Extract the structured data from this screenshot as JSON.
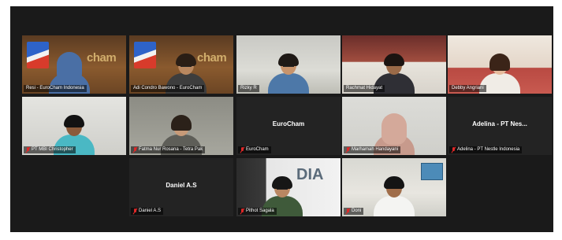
{
  "meeting": {
    "participants": [
      {
        "name": "Resi - EuroCham Indonesia",
        "video": true,
        "active_speaker": true,
        "muted": false
      },
      {
        "name": "Adi Condro Bawono - EuroCham",
        "video": true,
        "muted": false
      },
      {
        "name": "Rizky R",
        "video": true,
        "muted": false
      },
      {
        "name": "Rachmat Hidayat",
        "video": true,
        "muted": false
      },
      {
        "name": "Debby Angriani",
        "video": true,
        "muted": false
      },
      {
        "name": "PT MBI Christopher",
        "video": true,
        "muted": true
      },
      {
        "name": "Fatma Nur Rosana - Tetra Pak",
        "video": true,
        "muted": true
      },
      {
        "name": "EuroCham",
        "display_name": "EuroCham",
        "video": false,
        "muted": true
      },
      {
        "name": "Marhamah Handayani",
        "video": true,
        "muted": true
      },
      {
        "name": "Adelina - PT Nestle Indonesia",
        "display_name": "Adelina - PT Nes...",
        "video": false,
        "muted": true
      },
      {
        "name": "Daniel A.S",
        "display_name": "Daniel A.S",
        "video": false,
        "muted": true
      },
      {
        "name": "Pithot Sagala",
        "video": true,
        "muted": true
      },
      {
        "name": "Doni",
        "video": true,
        "muted": true
      }
    ],
    "colors": {
      "background": "#1a1a1a",
      "tile": "#232323",
      "active_speaker_border": "#d9d24a",
      "muted_icon": "#e02828"
    },
    "icons": {
      "muted": "microphone-muted-icon"
    },
    "background_text": {
      "brand": "cham",
      "banner": "DIA"
    }
  }
}
